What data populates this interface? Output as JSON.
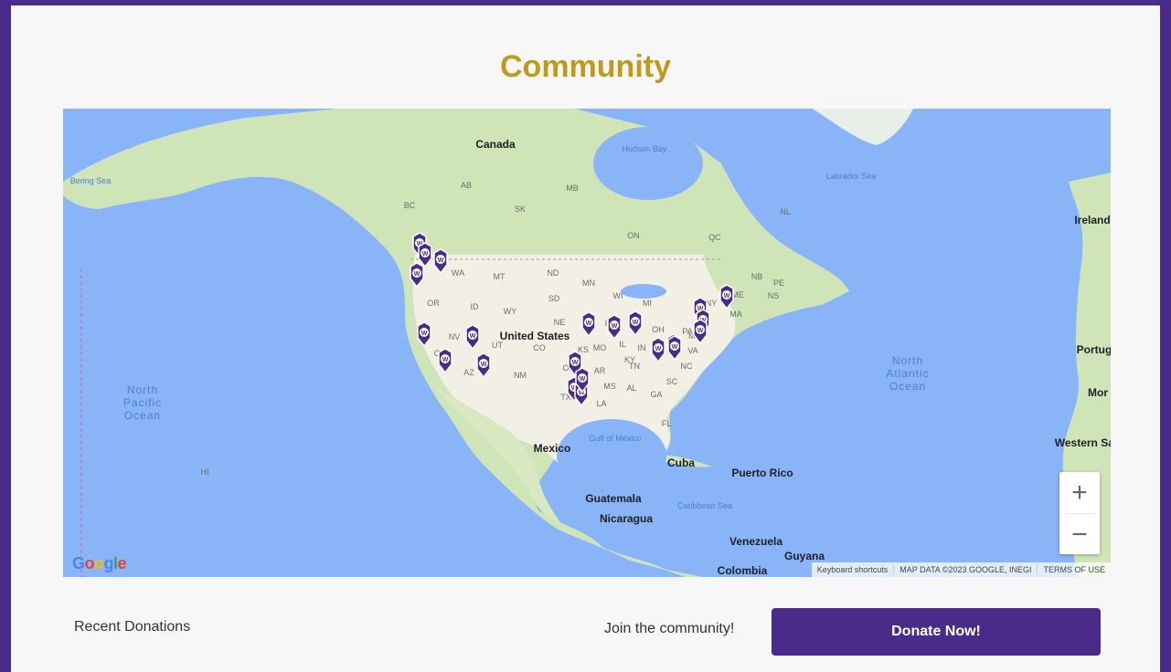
{
  "page": {
    "title": "Community"
  },
  "map": {
    "countries": [
      "Canada",
      "United States",
      "Mexico",
      "Cuba",
      "Puerto Rico",
      "Guatemala",
      "Nicaragua",
      "Venezuela",
      "Guyana",
      "Colombia",
      "Ireland",
      "Portug",
      "Mor",
      "Western Sahara"
    ],
    "oceans": [
      "North\nPacific\nOcean",
      "North\nAtlantic\nOcean"
    ],
    "seas": [
      "Bering Sea",
      "Hudson Bay",
      "Labrador Sea",
      "Gulf of Mexico",
      "Caribbean Sea"
    ],
    "regions": [
      "BC",
      "AB",
      "SK",
      "MB",
      "ON",
      "QC",
      "NL",
      "NB",
      "PE",
      "NS",
      "MT",
      "ND",
      "MN",
      "WA",
      "OR",
      "ID",
      "WY",
      "SD",
      "WI",
      "MI",
      "NE",
      "IA",
      "NV",
      "UT",
      "CO",
      "CA",
      "KS",
      "MO",
      "IL",
      "IN",
      "OH",
      "PA",
      "NY",
      "VA",
      "NC",
      "KY",
      "TN",
      "SC",
      "GA",
      "AL",
      "MS",
      "AR",
      "OK",
      "TX",
      "LA",
      "FL",
      "AZ",
      "NM",
      "ME",
      "MA",
      "MD",
      "HI"
    ],
    "marker_count": 22,
    "marker_letter": "W",
    "zoom_in": "+",
    "zoom_out": "−",
    "logo": "Google",
    "attribution": [
      "Keyboard shortcuts",
      "MAP DATA ©2023 GOOGLE, INEGI",
      "TERMS OF USE"
    ],
    "colors": {
      "water": "#8ab4f8",
      "land": "#cfe5b8",
      "us_land": "#f2efe4",
      "marker": "#4a2b8a"
    }
  },
  "footer": {
    "recent_donations": "Recent Donations",
    "join_text": "Join the community!",
    "donate_label": "Donate Now!"
  }
}
